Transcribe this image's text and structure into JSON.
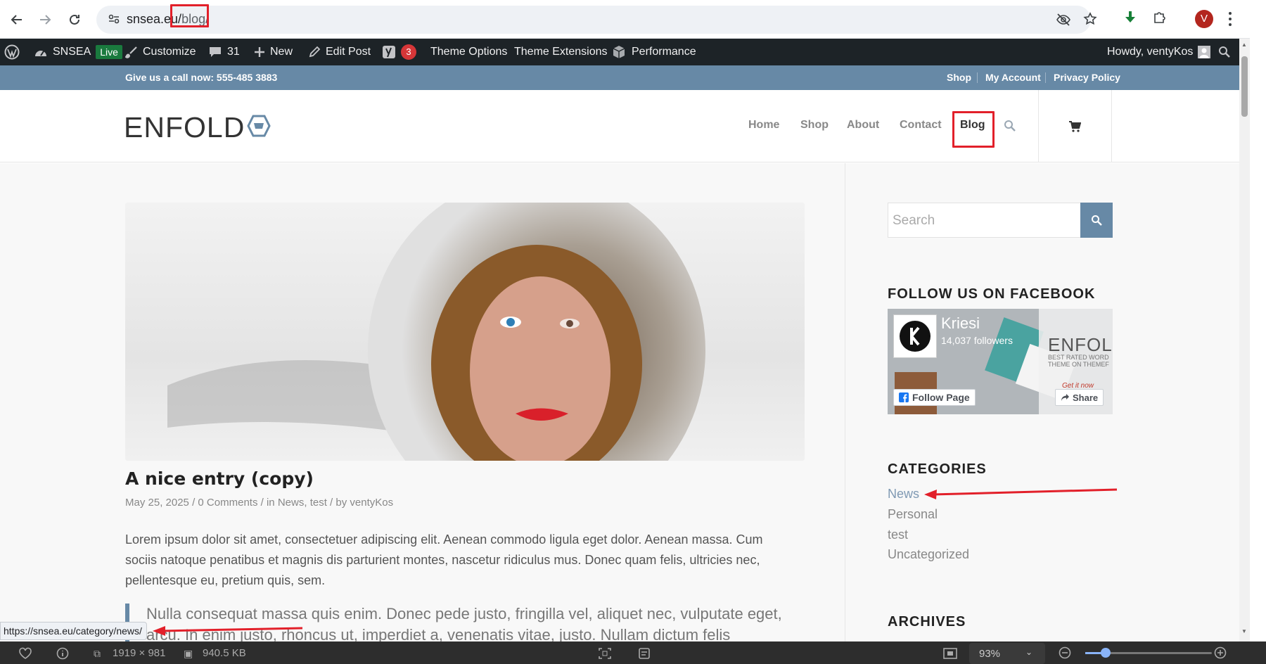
{
  "browser": {
    "url_host": "snsea.eu/",
    "url_path": "blog/",
    "avatar_letter": "V",
    "status_url": "https://snsea.eu/category/news/"
  },
  "admin_bar": {
    "site_name": "SNSEA",
    "live_label": "Live",
    "customize": "Customize",
    "comments_count": "31",
    "new": "New",
    "edit_post": "Edit Post",
    "yoast_badge": "3",
    "theme_options": "Theme Options",
    "theme_extensions": "Theme Extensions",
    "performance": "Performance",
    "howdy": "Howdy, ventyKos"
  },
  "top_bar": {
    "call_text": "Give us a call now: 555-485 3883",
    "links": [
      "Shop",
      "My Account",
      "Privacy Policy"
    ]
  },
  "header": {
    "logo": "ENFOLD",
    "nav": [
      "Home",
      "Shop",
      "About",
      "Contact",
      "Blog"
    ]
  },
  "post": {
    "title": "A nice entry (copy)",
    "date": "May 25, 2025",
    "comments": "0 Comments",
    "in_prefix": "in",
    "category_1": "News",
    "category_2": "test",
    "by_prefix": "by",
    "author": "ventyKos",
    "meta_sep": "/",
    "excerpt": "Lorem ipsum dolor sit amet, consectetuer adipiscing elit. Aenean commodo ligula eget dolor. Aenean massa. Cum sociis natoque penatibus et magnis dis parturient montes, nascetur ridiculus mus. Donec quam felis, ultricies nec, pellentesque eu, pretium quis, sem.",
    "quote": "Nulla consequat massa quis enim. Donec pede justo, fringilla vel, aliquet nec, vulputate eget, arcu. In enim justo, rhoncus ut, imperdiet a, venenatis vitae, justo. Nullam dictum felis"
  },
  "sidebar": {
    "search_placeholder": "Search",
    "facebook_title": "FOLLOW US ON FACEBOOK",
    "fb_page_name": "Kriesi",
    "fb_followers": "14,037 followers",
    "fb_follow": "Follow Page",
    "fb_share": "Share",
    "fb_banner_text": "ENFOLD",
    "fb_banner_sub_1": "BEST RATED WORD",
    "fb_banner_sub_2": "THEME ON THEMEF",
    "fb_getit": "Get it now",
    "categories_title": "CATEGORIES",
    "categories": [
      "News",
      "Personal",
      "test",
      "Uncategorized"
    ],
    "archives_title": "ARCHIVES"
  },
  "bottom_bar": {
    "dimensions": "1919 × 981",
    "filesize": "940.5 KB",
    "zoom": "93%"
  },
  "colors": {
    "accent": "#6789a6",
    "admin_bar": "#1d2327",
    "annotation_red": "#e2202a"
  }
}
